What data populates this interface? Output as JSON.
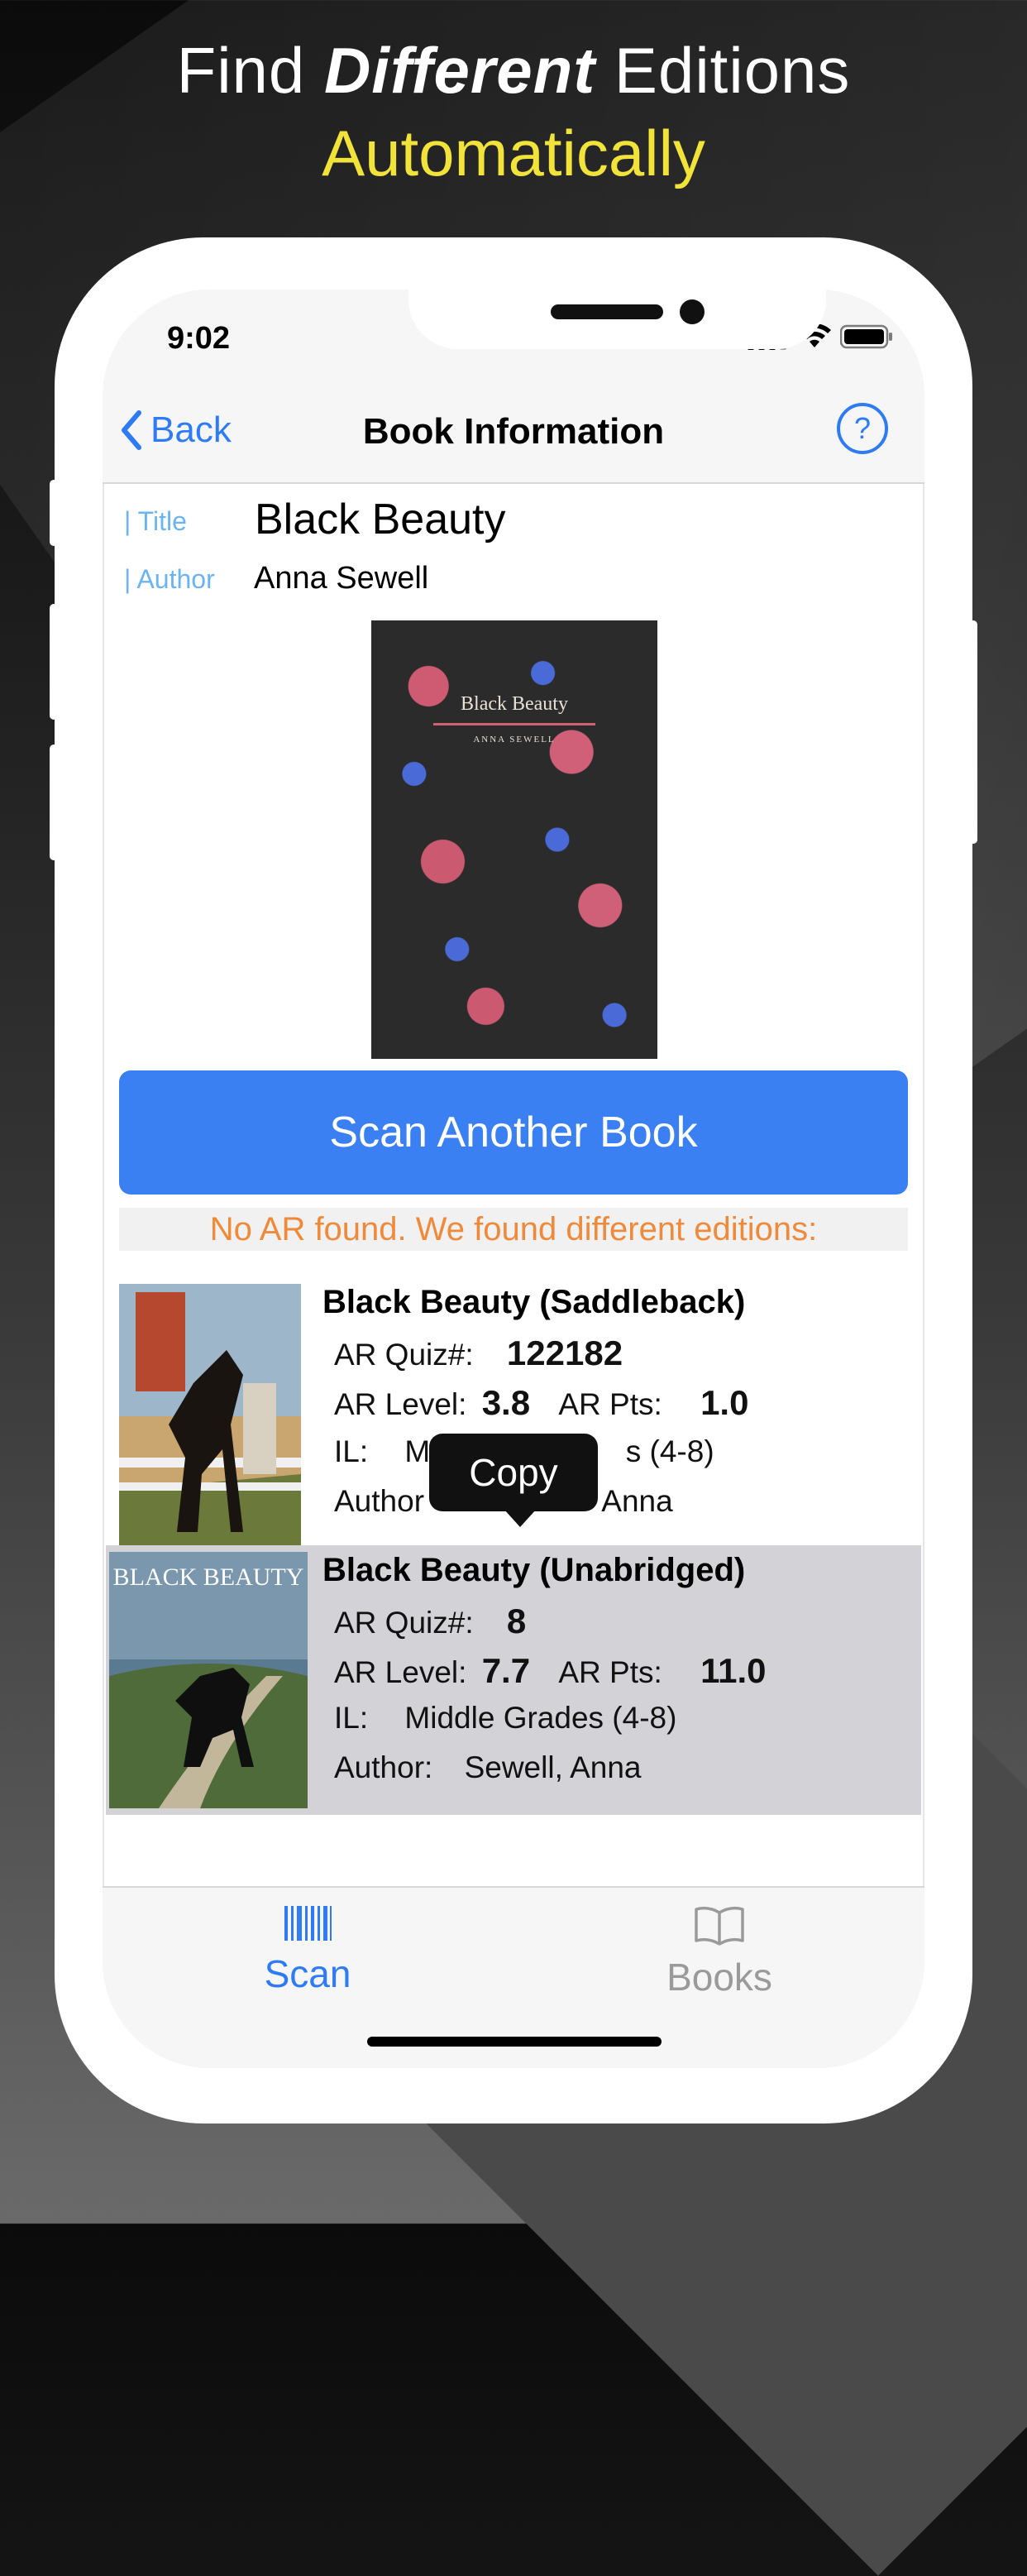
{
  "headline": {
    "line1_pre": "Find ",
    "line1_emph": "Different",
    "line1_post": " Editions",
    "line2": "Automatically"
  },
  "status_bar": {
    "time": "9:02"
  },
  "nav": {
    "back_label": "Back",
    "title": "Book Information",
    "help_icon": "?"
  },
  "book": {
    "title_label": "| Title",
    "title": "Black Beauty",
    "author_label": "| Author",
    "author": "Anna Sewell",
    "cover_title": "Black Beauty",
    "cover_author": "ANNA SEWELL"
  },
  "scan_button": "Scan Another Book",
  "notice": "No AR found. We found different editions:",
  "tooltip": "Copy",
  "labels": {
    "ar_quiz": "AR Quiz#:",
    "ar_level": "AR Level:",
    "ar_pts": "AR Pts:",
    "il": "IL:",
    "author": "Author:"
  },
  "editions": [
    {
      "title": "Black Beauty (Saddleback)",
      "ar_quiz": "122182",
      "ar_level": "3.8",
      "ar_pts": "1.0",
      "il_visible_left": "Mi",
      "il_visible_right": "s (4-8)",
      "author_visible_left": "Author",
      "author_visible_right": "Anna"
    },
    {
      "title": "Black Beauty (Unabridged)",
      "ar_quiz": "8",
      "ar_level": "7.7",
      "ar_pts": "11.0",
      "il": "Middle Grades (4-8)",
      "author": "Sewell, Anna",
      "cover_text": "BLACK BEAUTY"
    }
  ],
  "tabs": [
    {
      "label": "Scan",
      "icon": "barcode-icon",
      "active": true
    },
    {
      "label": "Books",
      "icon": "book-icon",
      "active": false
    }
  ],
  "colors": {
    "accent": "#2f7bf5",
    "notice": "#ee8a3a",
    "headline_yellow": "#f1e33a",
    "label_blue": "#6cb4ef",
    "inactive_tab": "#9a9a9a"
  }
}
